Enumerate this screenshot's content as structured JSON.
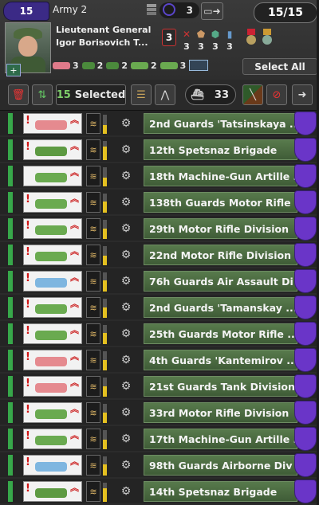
{
  "header": {
    "army_number": "15",
    "army_name": "Army 2",
    "commander_count": "3",
    "unit_total": "15/15",
    "rank": "Lieutenant General",
    "general_name": "Igor Borisovich T...",
    "skill_level": "3",
    "skills": [
      {
        "icon": "attack-icon",
        "symbol": "✕",
        "color": "#c33",
        "value": "3"
      },
      {
        "icon": "defense-icon",
        "symbol": "⬟",
        "color": "#c96",
        "value": "3"
      },
      {
        "icon": "planning-icon",
        "symbol": "⬢",
        "color": "#5a8",
        "value": "3"
      },
      {
        "icon": "logistics-icon",
        "symbol": "▮",
        "color": "#69c",
        "value": "3"
      }
    ],
    "composition": [
      {
        "icon": "tank-icon",
        "color": "#e07a8a",
        "count": "3"
      },
      {
        "icon": "spetsnaz-icon",
        "color": "#4b8a3c",
        "count": "2"
      },
      {
        "icon": "infantry-icon",
        "color": "#4b8a3c",
        "count": "2"
      },
      {
        "icon": "motor-rifle-icon",
        "color": "#6aaa50",
        "count": "2"
      },
      {
        "icon": "ifv-icon",
        "color": "#6aaa50",
        "count": "3"
      }
    ],
    "select_all_label": "Select All"
  },
  "toolbar": {
    "selected_count": "15",
    "selected_label": "Selected",
    "naval_count": "33"
  },
  "colors": {
    "accent_purple": "#6a35c8",
    "status_green": "#37a84a",
    "name_bar_green": "#4f6e44"
  },
  "divisions": [
    {
      "name": "2nd Guards 'Tatsinskaya ...",
      "unit_color": "#e58a8f",
      "warning": "!",
      "org": 0.45
    },
    {
      "name": "12th Spetsnaz Brigade",
      "unit_color": "#5d9a42",
      "warning": "!",
      "org": 0.7
    },
    {
      "name": "18th Machine-Gun Artille ...",
      "unit_color": "#6aaa50",
      "warning": "",
      "org": 0.45
    },
    {
      "name": "138th Guards Motor Rifle ...",
      "unit_color": "#6aaa50",
      "warning": "!",
      "org": 0.6
    },
    {
      "name": "29th Motor Rifle Division",
      "unit_color": "#6aaa50",
      "warning": "!",
      "org": 0.55
    },
    {
      "name": "22nd Motor Rifle Division",
      "unit_color": "#6aaa50",
      "warning": "!",
      "org": 0.5
    },
    {
      "name": "76h Guards Air Assault Di ...",
      "unit_color": "#7eb6e0",
      "warning": "!",
      "org": 0.6
    },
    {
      "name": "2nd Guards 'Tamanskay ...",
      "unit_color": "#6aaa50",
      "warning": "!",
      "org": 0.55
    },
    {
      "name": "25th Guards Motor Rifle ...",
      "unit_color": "#6aaa50",
      "warning": "!",
      "org": 0.6
    },
    {
      "name": "4th Guards 'Kantemirov ...",
      "unit_color": "#e58a8f",
      "warning": "!",
      "org": 0.55
    },
    {
      "name": "21st Guards Tank Division",
      "unit_color": "#e58a8f",
      "warning": "!",
      "org": 0.55
    },
    {
      "name": "33rd Motor Rifle Division",
      "unit_color": "#6aaa50",
      "warning": "!",
      "org": 0.55
    },
    {
      "name": "17th Machine-Gun Artille ...",
      "unit_color": "#6aaa50",
      "warning": "!",
      "org": 0.5
    },
    {
      "name": "98th Guards Airborne Div ...",
      "unit_color": "#7eb6e0",
      "warning": "!",
      "org": 0.6
    },
    {
      "name": "14th Spetsnaz Brigade",
      "unit_color": "#5d9a42",
      "warning": "!",
      "org": 0.7
    }
  ]
}
